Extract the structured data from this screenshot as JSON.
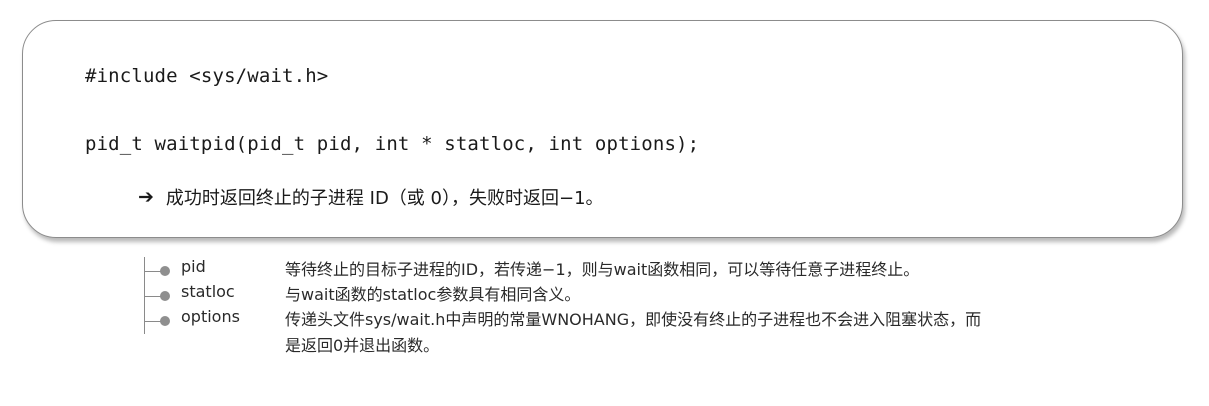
{
  "code": {
    "include_line": "#include <sys/wait.h>",
    "signature_line": "pid_t waitpid(pid_t pid, int * statloc, int options);",
    "result_arrow": "➔",
    "result_text": "成功时返回终止的子进程 ID（或 0），失败时返回−1。"
  },
  "params": [
    {
      "name": "pid",
      "description": "等待终止的目标子进程的ID，若传递−1，则与wait函数相同，可以等待任意子进程终止。"
    },
    {
      "name": "statloc",
      "description": "与wait函数的statloc参数具有相同含义。"
    },
    {
      "name": "options",
      "description": "传递头文件sys/wait.h中声明的常量WNOHANG，即使没有终止的子进程也不会进入阻塞状态，而是返回0并退出函数。"
    }
  ]
}
